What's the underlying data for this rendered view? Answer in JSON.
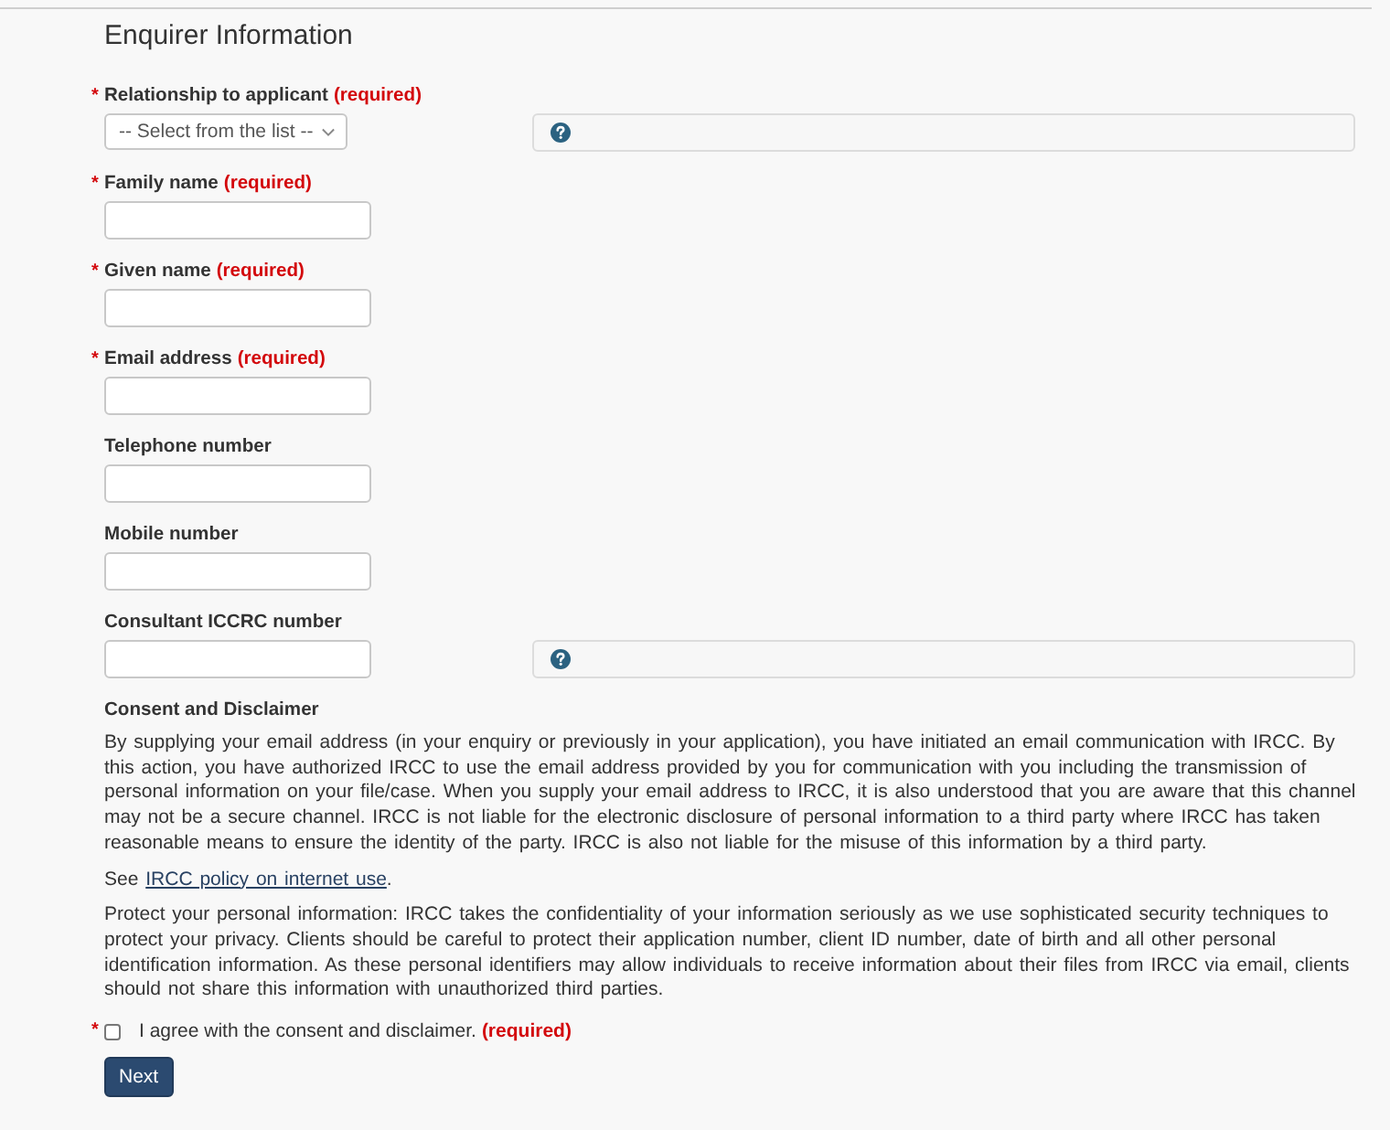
{
  "section": {
    "title": "Enquirer Information"
  },
  "fields": [
    {
      "kind": "select",
      "marker": "*",
      "label": "Relationship to applicant",
      "note": "(required)",
      "value": "-- Select from the list --",
      "help": true
    },
    {
      "kind": "text",
      "marker": "*",
      "label": "Family name",
      "note": "(required)",
      "help": false
    },
    {
      "kind": "text",
      "marker": "*",
      "label": "Given name",
      "note": "(required)",
      "help": false
    },
    {
      "kind": "text",
      "marker": "*",
      "label": "Email address",
      "note": "(required)",
      "help": false
    },
    {
      "kind": "text",
      "label": "Telephone number",
      "help": false
    },
    {
      "kind": "text",
      "label": "Mobile number",
      "help": false
    },
    {
      "kind": "text",
      "label": "Consultant ICCRC number",
      "help": true
    }
  ],
  "consent": {
    "title": "Consent and Disclaimer",
    "paragraphs": [
      {
        "kind": "text",
        "text": "By supplying your email address (in your enquiry or previously in your application), you have initiated an email communication with IRCC. By this action, you have authorized IRCC to use the email address provided by you for communication with you including the transmission of personal information on your file/case. When you supply your email address to IRCC, it is also understood that you are aware that this channel may not be a secure channel. IRCC is not liable for the electronic disclosure of personal information to a third party where IRCC has taken reasonable means to ensure the identity of the party. IRCC is also not liable for the misuse of this information by a third party."
      },
      {
        "kind": "link_line",
        "before": "See ",
        "link": "IRCC policy on internet use",
        "after": "."
      },
      {
        "kind": "text",
        "text": "Protect your personal information: IRCC takes the confidentiality of your information seriously as we use sophisticated security techniques to protect your privacy. Clients should be careful to protect their application number, client ID number, date of birth and all other personal identification information. As these personal identifiers may allow individuals to receive information about their files from IRCC via email, clients should not share this information with unauthorized third parties."
      }
    ]
  },
  "agree": {
    "marker": "*",
    "checked": false,
    "label": "I agree with the consent and disclaimer.",
    "note": "(required)"
  },
  "next_button": {
    "label": "Next"
  }
}
